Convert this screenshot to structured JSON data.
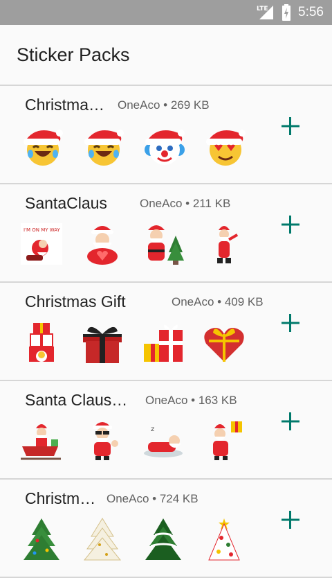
{
  "status": {
    "network": "LTE",
    "time": "5:56"
  },
  "app": {
    "title": "Sticker Packs"
  },
  "packs": [
    {
      "name": "Christma…",
      "meta": "OneAco • 269 KB",
      "stickers": [
        "santa-hat-tears-emoji",
        "santa-hat-tears-emoji",
        "santa-hat-clown-emoji",
        "santa-hat-heart-eyes-emoji"
      ]
    },
    {
      "name": "SantaClaus",
      "meta": "OneAco • 211 KB",
      "stickers": [
        "santa-on-my-way",
        "santa-heart",
        "santa-tree",
        "santa-dancing"
      ]
    },
    {
      "name": "Christmas Gift",
      "meta": "OneAco • 409 KB",
      "stickers": [
        "gift-stack",
        "black-gift-box",
        "red-gift-boxes",
        "heart-gift-box"
      ]
    },
    {
      "name": "Santa Claus…",
      "meta": "OneAco • 163 KB",
      "stickers": [
        "santa-sleigh",
        "santa-sunglasses",
        "santa-sleeping",
        "santa-gift"
      ]
    },
    {
      "name": "Christm…",
      "meta": "OneAco • 724 KB",
      "stickers": [
        "green-tree",
        "white-tree",
        "snowy-tree",
        "decorated-tree"
      ]
    }
  ],
  "colors": {
    "accent": "#00796b",
    "status_bar": "#9e9e9e"
  }
}
